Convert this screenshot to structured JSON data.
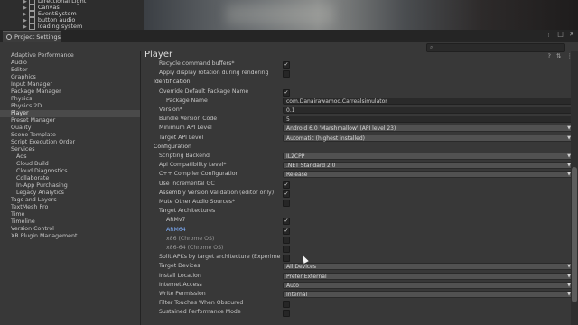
{
  "hierarchy": {
    "items": [
      "Directional Light",
      "Canvas",
      "EventSystem",
      "button audio",
      "loading system"
    ]
  },
  "window": {
    "tab_title": "Project Settings",
    "buttons": [
      "⋮",
      "□",
      "✕"
    ]
  },
  "search": {
    "placeholder": ""
  },
  "sidebar": {
    "items": [
      {
        "label": "Adaptive Performance",
        "sub": false
      },
      {
        "label": "Audio",
        "sub": false
      },
      {
        "label": "Editor",
        "sub": false
      },
      {
        "label": "Graphics",
        "sub": false
      },
      {
        "label": "Input Manager",
        "sub": false
      },
      {
        "label": "Package Manager",
        "sub": false
      },
      {
        "label": "Physics",
        "sub": false
      },
      {
        "label": "Physics 2D",
        "sub": false
      },
      {
        "label": "Player",
        "sub": false,
        "active": true
      },
      {
        "label": "Preset Manager",
        "sub": false
      },
      {
        "label": "Quality",
        "sub": false
      },
      {
        "label": "Scene Template",
        "sub": false
      },
      {
        "label": "Script Execution Order",
        "sub": false
      },
      {
        "label": "Services",
        "sub": false
      },
      {
        "label": "Ads",
        "sub": true
      },
      {
        "label": "Cloud Build",
        "sub": true
      },
      {
        "label": "Cloud Diagnostics",
        "sub": true
      },
      {
        "label": "Collaborate",
        "sub": true
      },
      {
        "label": "In-App Purchasing",
        "sub": true
      },
      {
        "label": "Legacy Analytics",
        "sub": true
      },
      {
        "label": "Tags and Layers",
        "sub": false
      },
      {
        "label": "TextMesh Pro",
        "sub": false
      },
      {
        "label": "Time",
        "sub": false
      },
      {
        "label": "Timeline",
        "sub": false
      },
      {
        "label": "Version Control",
        "sub": false
      },
      {
        "label": "XR Plugin Management",
        "sub": false
      }
    ]
  },
  "main": {
    "title": "Player",
    "header_icons": [
      "?",
      "⇅",
      "⋮"
    ],
    "rows": [
      {
        "label": "Recycle command buffers*",
        "kind": "checkbox",
        "checked": true
      },
      {
        "label": "Apply display rotation during rendering",
        "kind": "checkbox",
        "checked": false
      },
      {
        "label": "Identification",
        "kind": "header"
      },
      {
        "label": "Override Default Package Name",
        "kind": "checkbox",
        "checked": true
      },
      {
        "label": "Package Name",
        "kind": "field",
        "value": "com.Danairawamoo.Carrealsimulator",
        "indent": true
      },
      {
        "label": "Version*",
        "kind": "field",
        "value": "0.1"
      },
      {
        "label": "Bundle Version Code",
        "kind": "field",
        "value": "5"
      },
      {
        "label": "Minimum API Level",
        "kind": "dropdown",
        "value": "Android 6.0 'Marshmallow' (API level 23)"
      },
      {
        "label": "Target API Level",
        "kind": "dropdown",
        "value": "Automatic (highest installed)"
      },
      {
        "label": "Configuration",
        "kind": "header"
      },
      {
        "label": "Scripting Backend",
        "kind": "dropdown",
        "value": "IL2CPP"
      },
      {
        "label": "Api Compatibility Level*",
        "kind": "dropdown",
        "value": ".NET Standard 2.0"
      },
      {
        "label": "C++ Compiler Configuration",
        "kind": "dropdown",
        "value": "Release"
      },
      {
        "label": "Use Incremental GC",
        "kind": "checkbox",
        "checked": true
      },
      {
        "label": "Assembly Version Validation (editor only)",
        "kind": "checkbox",
        "checked": true
      },
      {
        "label": "Mute Other Audio Sources*",
        "kind": "checkbox",
        "checked": false
      },
      {
        "label": "Target Architectures",
        "kind": "label"
      },
      {
        "label": "ARMv7",
        "kind": "checkbox",
        "checked": true,
        "indent": true
      },
      {
        "label": "ARM64",
        "kind": "checkbox",
        "checked": true,
        "indent": true,
        "blue": true
      },
      {
        "label": "x86 (Chrome OS)",
        "kind": "checkbox",
        "checked": false,
        "indent": true,
        "dim": true
      },
      {
        "label": "x86-64 (Chrome OS)",
        "kind": "checkbox",
        "checked": false,
        "indent": true,
        "dim": true
      },
      {
        "label": "Split APKs by target architecture (Experime",
        "kind": "checkbox",
        "checked": false
      },
      {
        "label": "Target Devices",
        "kind": "dropdown",
        "value": "All Devices"
      },
      {
        "label": "Install Location",
        "kind": "dropdown",
        "value": "Prefer External"
      },
      {
        "label": "Internet Access",
        "kind": "dropdown",
        "value": "Auto"
      },
      {
        "label": "Write Permission",
        "kind": "dropdown",
        "value": "Internal"
      },
      {
        "label": "Filter Touches When Obscured",
        "kind": "checkbox",
        "checked": false
      },
      {
        "label": "Sustained Performance Mode",
        "kind": "checkbox",
        "checked": false
      }
    ]
  }
}
